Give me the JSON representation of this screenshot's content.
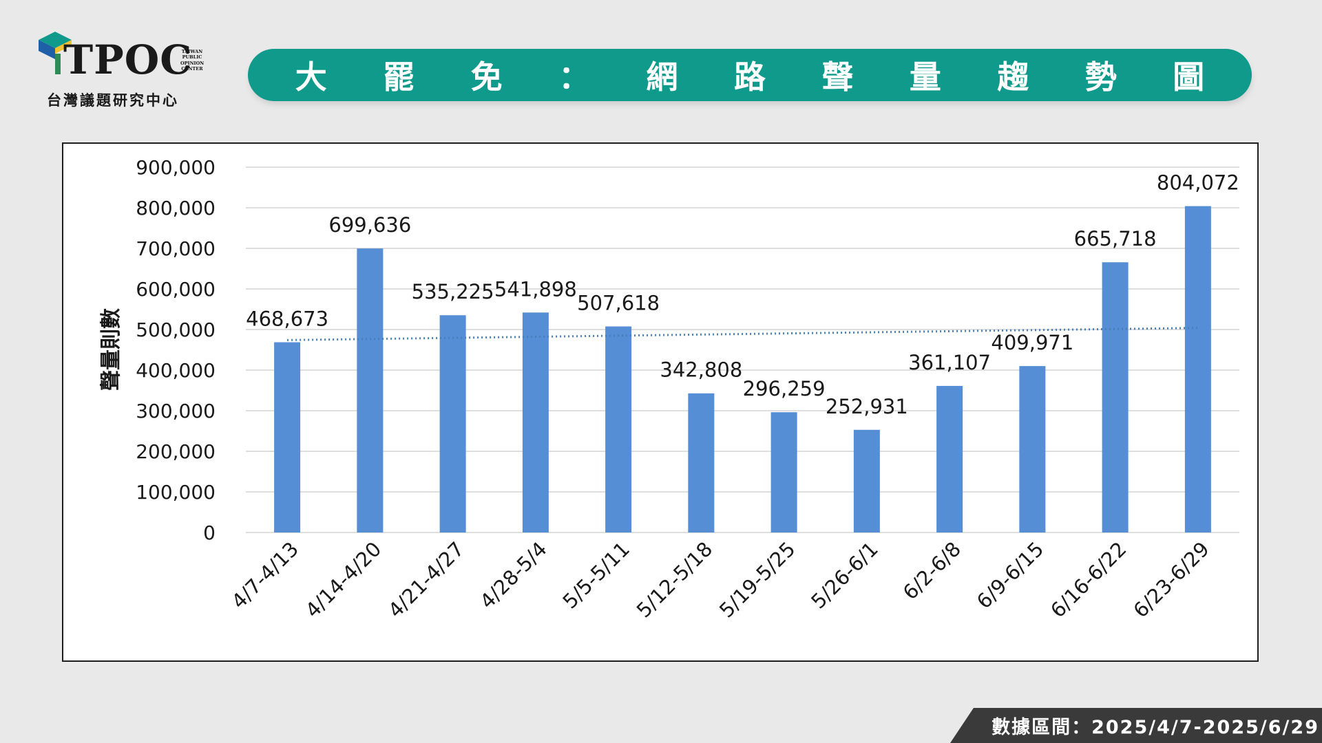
{
  "logo": {
    "brand": "TPOC",
    "side_lines": [
      "TAIWAN",
      "PUBLIC",
      "OPINION",
      "CENTER"
    ],
    "subtitle": "台灣議題研究中心",
    "colors": {
      "teal": "#109a8c",
      "blue": "#1f5fa8",
      "yellow": "#f2c12e",
      "red": "#c0392b",
      "green": "#2e8b57"
    }
  },
  "title": {
    "chars": [
      "大",
      "罷",
      "免",
      "：",
      "網",
      "路",
      "聲",
      "量",
      "趨",
      "勢",
      "圖"
    ],
    "color": "#109a8c"
  },
  "footer": {
    "text": "數據區間：2025/4/7-2025/6/29"
  },
  "chart_data": {
    "type": "bar",
    "ylabel": "聲量則數",
    "ylim": [
      0,
      900000
    ],
    "yticks": [
      0,
      100000,
      200000,
      300000,
      400000,
      500000,
      600000,
      700000,
      800000,
      900000
    ],
    "ytick_labels": [
      "0",
      "100,000",
      "200,000",
      "300,000",
      "400,000",
      "500,000",
      "600,000",
      "700,000",
      "800,000",
      "900,000"
    ],
    "categories": [
      "4/7-4/13",
      "4/14-4/20",
      "4/21-4/27",
      "4/28-5/4",
      "5/5-5/11",
      "5/12-5/18",
      "5/19-5/25",
      "5/26-6/1",
      "6/2-6/8",
      "6/9-6/15",
      "6/16-6/22",
      "6/23-6/29"
    ],
    "values": [
      468673,
      699636,
      535225,
      541898,
      507618,
      342808,
      296259,
      252931,
      361107,
      409971,
      665718,
      804072
    ],
    "value_labels": [
      "468,673",
      "699,636",
      "535,225",
      "541,898",
      "507,618",
      "342,808",
      "296,259",
      "252,931",
      "361,107",
      "409,971",
      "665,718",
      "804,072"
    ],
    "trendline": {
      "style": "dotted",
      "start": 474000,
      "end": 504000
    },
    "grid": true,
    "bar_color": "#558ed5",
    "trend_color": "#4a7ebb"
  }
}
